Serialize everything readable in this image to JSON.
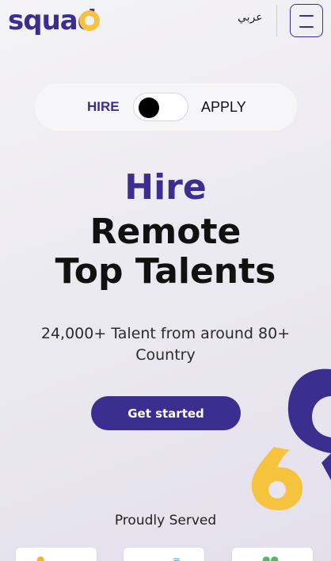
{
  "header": {
    "logo_text": "squad",
    "language_label": "عربي",
    "menu_icon": "hamburger-menu-icon"
  },
  "toggle": {
    "hire_label": "HIRE",
    "apply_label": "APPLY",
    "state": "hire"
  },
  "hero": {
    "line1": "Hire",
    "line2": "Remote",
    "line3": "Top Talents",
    "subtitle": "24,000+ Talent from around 80+ Country"
  },
  "cta": {
    "label": "Get started"
  },
  "clients": {
    "heading": "Proudly Served"
  },
  "colors": {
    "brand_purple": "#3b2e8e",
    "brand_yellow": "#f6c33f"
  }
}
